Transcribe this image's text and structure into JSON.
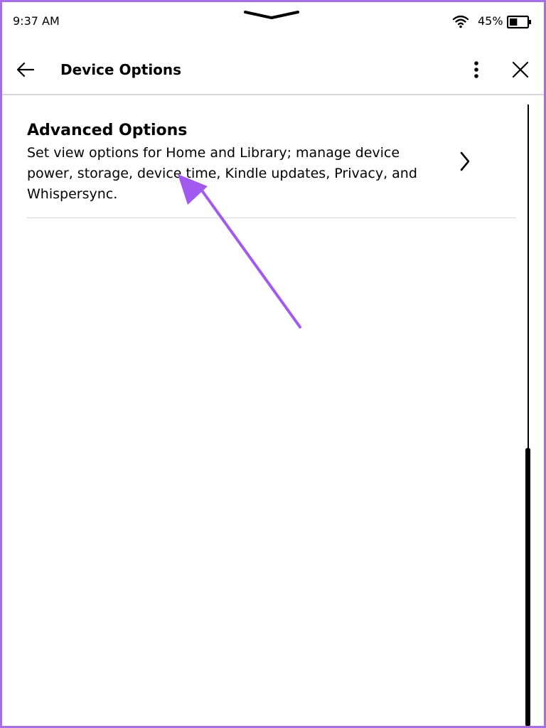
{
  "status_bar": {
    "time": "9:37 AM",
    "battery_percent": "45%",
    "battery_level": 0.45
  },
  "header": {
    "title": "Device Options"
  },
  "options": [
    {
      "title": "Advanced Options",
      "description": "Set view options for Home and Library; manage device power, storage, device time, Kindle updates, Privacy, and Whispersync."
    }
  ],
  "icons": {
    "back": "back-arrow-icon",
    "more": "more-vertical-icon",
    "close": "close-icon",
    "chevron": "chevron-right-icon",
    "wifi": "wifi-icon",
    "battery": "battery-icon"
  },
  "colors": {
    "annotation": "#a259f0",
    "frame": "#a66ee6",
    "divider": "#d6d6d6"
  }
}
